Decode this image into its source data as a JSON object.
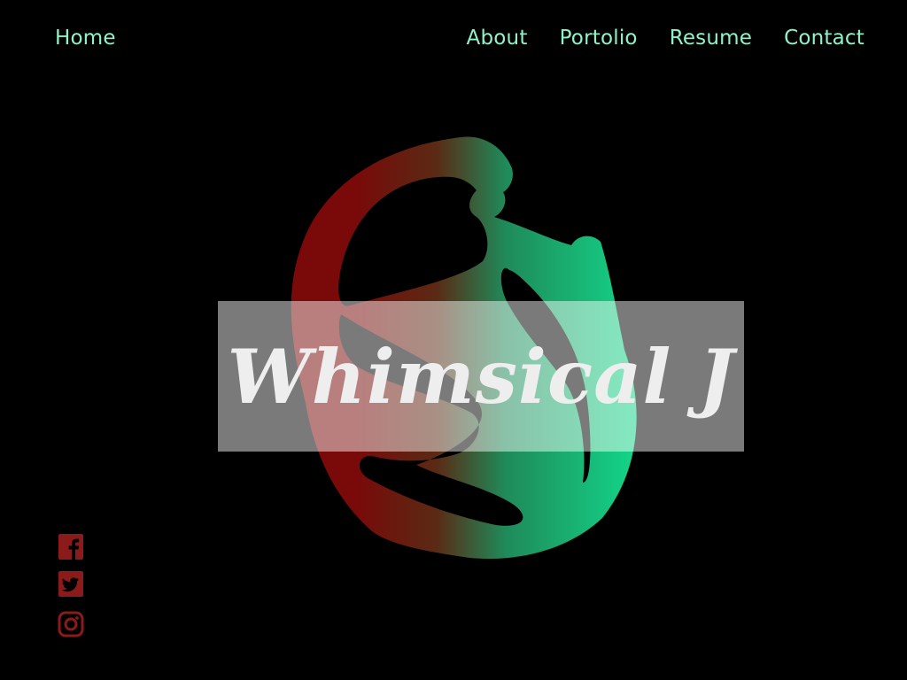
{
  "nav": {
    "home": "Home",
    "links": [
      {
        "label": "About"
      },
      {
        "label": "Portolio"
      },
      {
        "label": "Resume"
      },
      {
        "label": "Contact"
      }
    ]
  },
  "hero": {
    "title": "Whimsical J"
  },
  "social": {
    "icons": [
      "facebook-icon",
      "twitter-icon",
      "instagram-icon"
    ],
    "color": "#8b1a1a"
  },
  "colors": {
    "background": "#000000",
    "nav_text": "#8ff2c9",
    "logo_gradient_start": "#8b0a0a",
    "logo_gradient_end": "#14d38a",
    "banner_text": "#eeeeee"
  }
}
